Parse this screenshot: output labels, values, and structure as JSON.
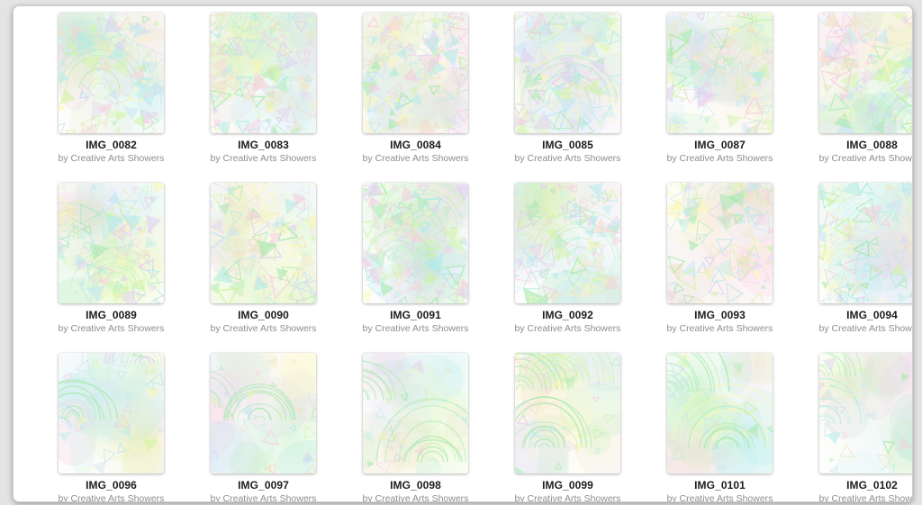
{
  "window": {
    "background_color": "#e4e4e4",
    "card_background_color": "#ffffff",
    "card_border_color": "#cfcfcf"
  },
  "gallery": {
    "columns": 6,
    "rows": 3,
    "title_color": "#1c1c1c",
    "byline_color": "#8d8d8d",
    "items": [
      {
        "title": "IMG_0082",
        "byline": "by Creative Arts Showers",
        "art": "pastel-triangles-green"
      },
      {
        "title": "IMG_0083",
        "byline": "by Creative Arts Showers",
        "art": "pastel-triangles-tan"
      },
      {
        "title": "IMG_0084",
        "byline": "by Creative Arts Showers",
        "art": "pastel-triangles-yellow"
      },
      {
        "title": "IMG_0085",
        "byline": "by Creative Arts Showers",
        "art": "pastel-triangles-mint"
      },
      {
        "title": "IMG_0087",
        "byline": "by Creative Arts Showers",
        "art": "pastel-triangles-lemon"
      },
      {
        "title": "IMG_0088",
        "byline": "by Creative Arts Showers",
        "art": "pastel-triangles-blue"
      },
      {
        "title": "IMG_0089",
        "byline": "by Creative Arts Showers",
        "art": "pastel-triangles-aqua"
      },
      {
        "title": "IMG_0090",
        "byline": "by Creative Arts Showers",
        "art": "pastel-triangles-sand"
      },
      {
        "title": "IMG_0091",
        "byline": "by Creative Arts Showers",
        "art": "pastel-triangles-lilac"
      },
      {
        "title": "IMG_0092",
        "byline": "by Creative Arts Showers",
        "art": "pastel-triangles-pink"
      },
      {
        "title": "IMG_0093",
        "byline": "by Creative Arts Showers",
        "art": "pastel-triangles-lime"
      },
      {
        "title": "IMG_0094",
        "byline": "by Creative Arts Showers",
        "art": "pastel-triangles-sky"
      },
      {
        "title": "IMG_0096",
        "byline": "by Creative Arts Showers",
        "art": "pastel-arcs-green"
      },
      {
        "title": "IMG_0097",
        "byline": "by Creative Arts Showers",
        "art": "pastel-arcs-yellow"
      },
      {
        "title": "IMG_0098",
        "byline": "by Creative Arts Showers",
        "art": "pastel-arcs-mint"
      },
      {
        "title": "IMG_0099",
        "byline": "by Creative Arts Showers",
        "art": "pastel-arcs-lemon"
      },
      {
        "title": "IMG_0101",
        "byline": "by Creative Arts Showers",
        "art": "pastel-arcs-aqua"
      },
      {
        "title": "IMG_0102",
        "byline": "by Creative Arts Showers",
        "art": "pastel-arcs-lime"
      }
    ]
  },
  "palette": {
    "green": "#7fe08a",
    "lime": "#bdf07a",
    "yellow": "#fbf39a",
    "cyan": "#8fe3e0",
    "sky": "#a8d8f0",
    "pink": "#f6b6d2",
    "lilac": "#d3bdea",
    "tan": "#e8d7a8",
    "paper": "#fdfdfa"
  }
}
